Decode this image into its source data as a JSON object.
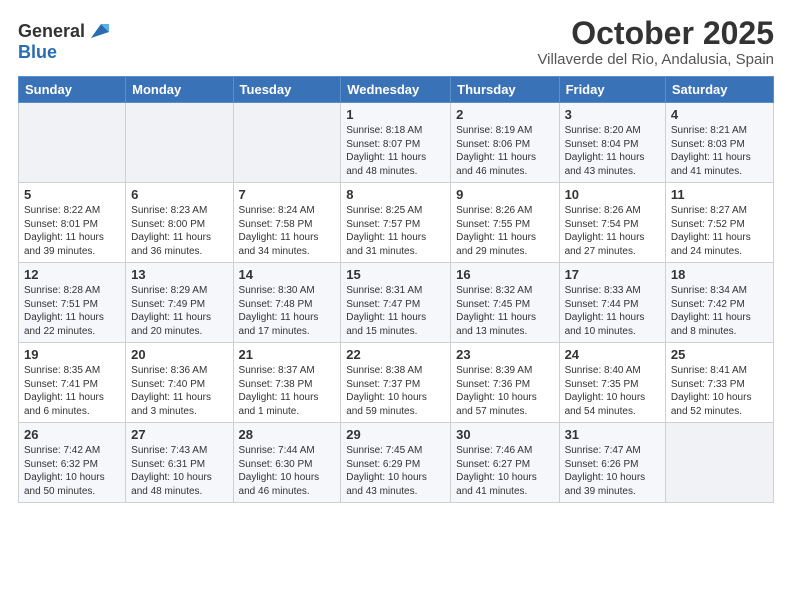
{
  "header": {
    "logo_general": "General",
    "logo_blue": "Blue",
    "title": "October 2025",
    "location": "Villaverde del Rio, Andalusia, Spain"
  },
  "days_of_week": [
    "Sunday",
    "Monday",
    "Tuesday",
    "Wednesday",
    "Thursday",
    "Friday",
    "Saturday"
  ],
  "weeks": [
    [
      {
        "day": "",
        "info": ""
      },
      {
        "day": "",
        "info": ""
      },
      {
        "day": "",
        "info": ""
      },
      {
        "day": "1",
        "info": "Sunrise: 8:18 AM\nSunset: 8:07 PM\nDaylight: 11 hours and 48 minutes."
      },
      {
        "day": "2",
        "info": "Sunrise: 8:19 AM\nSunset: 8:06 PM\nDaylight: 11 hours and 46 minutes."
      },
      {
        "day": "3",
        "info": "Sunrise: 8:20 AM\nSunset: 8:04 PM\nDaylight: 11 hours and 43 minutes."
      },
      {
        "day": "4",
        "info": "Sunrise: 8:21 AM\nSunset: 8:03 PM\nDaylight: 11 hours and 41 minutes."
      }
    ],
    [
      {
        "day": "5",
        "info": "Sunrise: 8:22 AM\nSunset: 8:01 PM\nDaylight: 11 hours and 39 minutes."
      },
      {
        "day": "6",
        "info": "Sunrise: 8:23 AM\nSunset: 8:00 PM\nDaylight: 11 hours and 36 minutes."
      },
      {
        "day": "7",
        "info": "Sunrise: 8:24 AM\nSunset: 7:58 PM\nDaylight: 11 hours and 34 minutes."
      },
      {
        "day": "8",
        "info": "Sunrise: 8:25 AM\nSunset: 7:57 PM\nDaylight: 11 hours and 31 minutes."
      },
      {
        "day": "9",
        "info": "Sunrise: 8:26 AM\nSunset: 7:55 PM\nDaylight: 11 hours and 29 minutes."
      },
      {
        "day": "10",
        "info": "Sunrise: 8:26 AM\nSunset: 7:54 PM\nDaylight: 11 hours and 27 minutes."
      },
      {
        "day": "11",
        "info": "Sunrise: 8:27 AM\nSunset: 7:52 PM\nDaylight: 11 hours and 24 minutes."
      }
    ],
    [
      {
        "day": "12",
        "info": "Sunrise: 8:28 AM\nSunset: 7:51 PM\nDaylight: 11 hours and 22 minutes."
      },
      {
        "day": "13",
        "info": "Sunrise: 8:29 AM\nSunset: 7:49 PM\nDaylight: 11 hours and 20 minutes."
      },
      {
        "day": "14",
        "info": "Sunrise: 8:30 AM\nSunset: 7:48 PM\nDaylight: 11 hours and 17 minutes."
      },
      {
        "day": "15",
        "info": "Sunrise: 8:31 AM\nSunset: 7:47 PM\nDaylight: 11 hours and 15 minutes."
      },
      {
        "day": "16",
        "info": "Sunrise: 8:32 AM\nSunset: 7:45 PM\nDaylight: 11 hours and 13 minutes."
      },
      {
        "day": "17",
        "info": "Sunrise: 8:33 AM\nSunset: 7:44 PM\nDaylight: 11 hours and 10 minutes."
      },
      {
        "day": "18",
        "info": "Sunrise: 8:34 AM\nSunset: 7:42 PM\nDaylight: 11 hours and 8 minutes."
      }
    ],
    [
      {
        "day": "19",
        "info": "Sunrise: 8:35 AM\nSunset: 7:41 PM\nDaylight: 11 hours and 6 minutes."
      },
      {
        "day": "20",
        "info": "Sunrise: 8:36 AM\nSunset: 7:40 PM\nDaylight: 11 hours and 3 minutes."
      },
      {
        "day": "21",
        "info": "Sunrise: 8:37 AM\nSunset: 7:38 PM\nDaylight: 11 hours and 1 minute."
      },
      {
        "day": "22",
        "info": "Sunrise: 8:38 AM\nSunset: 7:37 PM\nDaylight: 10 hours and 59 minutes."
      },
      {
        "day": "23",
        "info": "Sunrise: 8:39 AM\nSunset: 7:36 PM\nDaylight: 10 hours and 57 minutes."
      },
      {
        "day": "24",
        "info": "Sunrise: 8:40 AM\nSunset: 7:35 PM\nDaylight: 10 hours and 54 minutes."
      },
      {
        "day": "25",
        "info": "Sunrise: 8:41 AM\nSunset: 7:33 PM\nDaylight: 10 hours and 52 minutes."
      }
    ],
    [
      {
        "day": "26",
        "info": "Sunrise: 7:42 AM\nSunset: 6:32 PM\nDaylight: 10 hours and 50 minutes."
      },
      {
        "day": "27",
        "info": "Sunrise: 7:43 AM\nSunset: 6:31 PM\nDaylight: 10 hours and 48 minutes."
      },
      {
        "day": "28",
        "info": "Sunrise: 7:44 AM\nSunset: 6:30 PM\nDaylight: 10 hours and 46 minutes."
      },
      {
        "day": "29",
        "info": "Sunrise: 7:45 AM\nSunset: 6:29 PM\nDaylight: 10 hours and 43 minutes."
      },
      {
        "day": "30",
        "info": "Sunrise: 7:46 AM\nSunset: 6:27 PM\nDaylight: 10 hours and 41 minutes."
      },
      {
        "day": "31",
        "info": "Sunrise: 7:47 AM\nSunset: 6:26 PM\nDaylight: 10 hours and 39 minutes."
      },
      {
        "day": "",
        "info": ""
      }
    ]
  ]
}
